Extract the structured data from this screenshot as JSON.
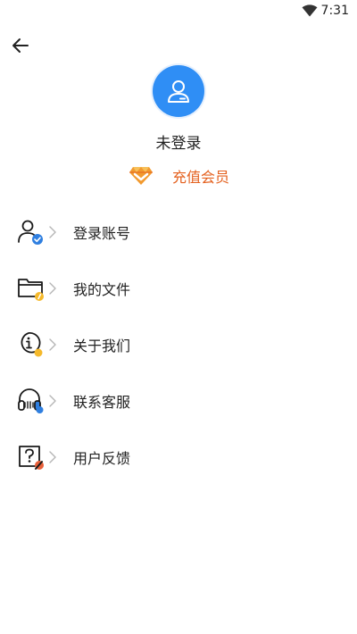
{
  "status_bar": {
    "time": "7:31",
    "wifi_icon": "wifi-icon"
  },
  "header": {
    "back_icon": "arrow-left-icon"
  },
  "profile": {
    "avatar_icon": "user-avatar-icon",
    "avatar_color": "#2f8ef5",
    "username": "未登录"
  },
  "vip": {
    "icon": "diamond-icon",
    "label": "充值会员",
    "color": "#e4611f"
  },
  "menu": {
    "items": [
      {
        "label": "登录账号",
        "icon": "user-check-icon",
        "badge_color": "#2f7fe0"
      },
      {
        "label": "我的文件",
        "icon": "folder-icon",
        "badge_color": "#f5b92b"
      },
      {
        "label": "关于我们",
        "icon": "info-chat-icon",
        "badge_color": "#f5b92b"
      },
      {
        "label": "联系客服",
        "icon": "headphones-icon",
        "badge_color": "#2f7fe0"
      },
      {
        "label": "用户反馈",
        "icon": "feedback-edit-icon",
        "badge_color": "#e8603a"
      }
    ]
  }
}
